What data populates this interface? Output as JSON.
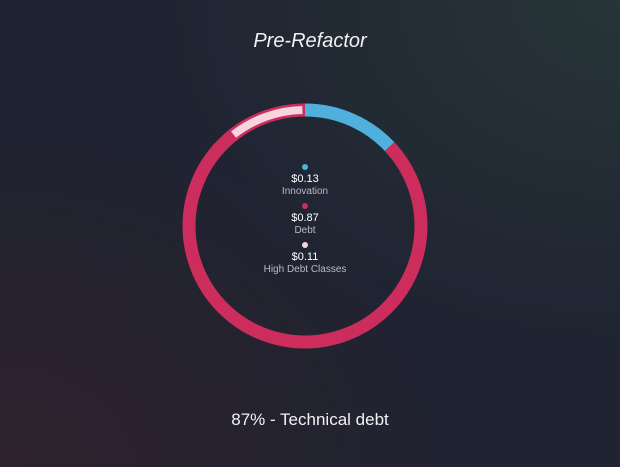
{
  "chart_data": {
    "type": "pie",
    "title": "Pre-Refactor",
    "slices": [
      {
        "label": "Innovation",
        "value": 0.13,
        "display": "$0.13",
        "color": "#4fb0dd"
      },
      {
        "label": "Debt",
        "value": 0.87,
        "display": "$0.87",
        "color": "#cc2d5c"
      },
      {
        "label": "High Debt Classes",
        "value": 0.11,
        "display": "$0.11",
        "color": "#f7d4df"
      }
    ],
    "footer": "87% - Technical debt"
  }
}
